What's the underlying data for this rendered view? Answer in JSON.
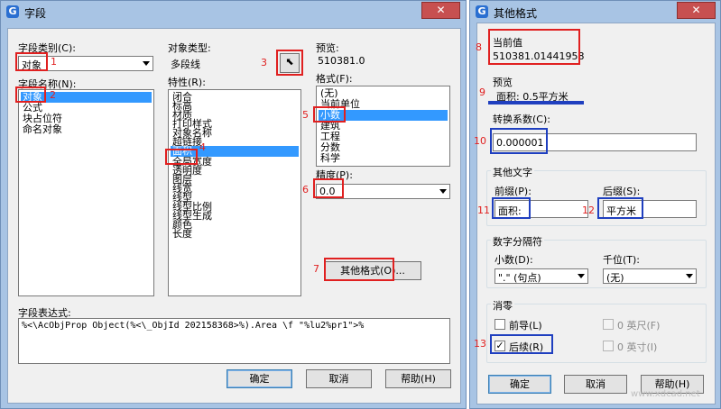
{
  "dialog1": {
    "title": "字段",
    "close": "✕",
    "field_category_label": "字段类别(C):",
    "field_category_value": "对象",
    "field_name_label": "字段名称(N):",
    "field_names": [
      "对象",
      "公式",
      "块占位符",
      "命名对象"
    ],
    "object_type_label": "对象类型:",
    "object_type_value": "多段线",
    "property_label": "特性(R):",
    "properties": [
      "闭合",
      "标高",
      "材质",
      "打印样式",
      "对象名称",
      "超链接",
      "面积",
      "全局宽度",
      "透明度",
      "图层",
      "线宽",
      "线型",
      "线型比例",
      "线型生成",
      "颜色",
      "长度"
    ],
    "preview_label": "预览:",
    "preview_value": "510381.0",
    "format_label": "格式(F):",
    "formats": [
      "(无)",
      "当前单位",
      "小数",
      "建筑",
      "工程",
      "分数",
      "科学"
    ],
    "precision_label": "精度(P):",
    "precision_value": "0.0",
    "other_format_button": "其他格式(O)...",
    "expression_label": "字段表达式:",
    "expression_value": "%<\\AcObjProp Object(%<\\_ObjId 202158368>%).Area \\f \"%lu2%pr1\">%",
    "ok": "确定",
    "cancel": "取消",
    "help": "帮助(H)"
  },
  "dialog2": {
    "title": "其他格式",
    "close": "✕",
    "current_value_label": "当前值",
    "current_value": "510381.01441958",
    "preview_label": "预览",
    "preview_value": "面积: 0.5平方米",
    "conversion_label": "转换系数(C):",
    "conversion_value": "0.000001",
    "other_text_group": "其他文字",
    "prefix_label": "前缀(P):",
    "prefix_value": "面积:",
    "suffix_label": "后缀(S):",
    "suffix_value": "平方米",
    "separator_group": "数字分隔符",
    "decimal_label": "小数(D):",
    "decimal_value": "\".\" (句点)",
    "thousands_label": "千位(T):",
    "thousands_value": "(无)",
    "zero_group": "消零",
    "leading_label": "前导(L)",
    "trailing_label": "后续(R)",
    "feet_label": "0 英尺(F)",
    "inches_label": "0 英寸(I)",
    "ok": "确定",
    "cancel": "取消",
    "help": "帮助(H)"
  },
  "annotations": [
    "1",
    "2",
    "3",
    "4",
    "5",
    "6",
    "7",
    "8",
    "9",
    "10",
    "11",
    "12",
    "13"
  ],
  "watermark": "www.xdcad.net",
  "colors": {
    "annotation_red": "#e02020",
    "annotation_blue": "#1f3fbf",
    "selection": "#3399ff",
    "titlebar": "#a8c4e4",
    "close": "#c75050"
  }
}
